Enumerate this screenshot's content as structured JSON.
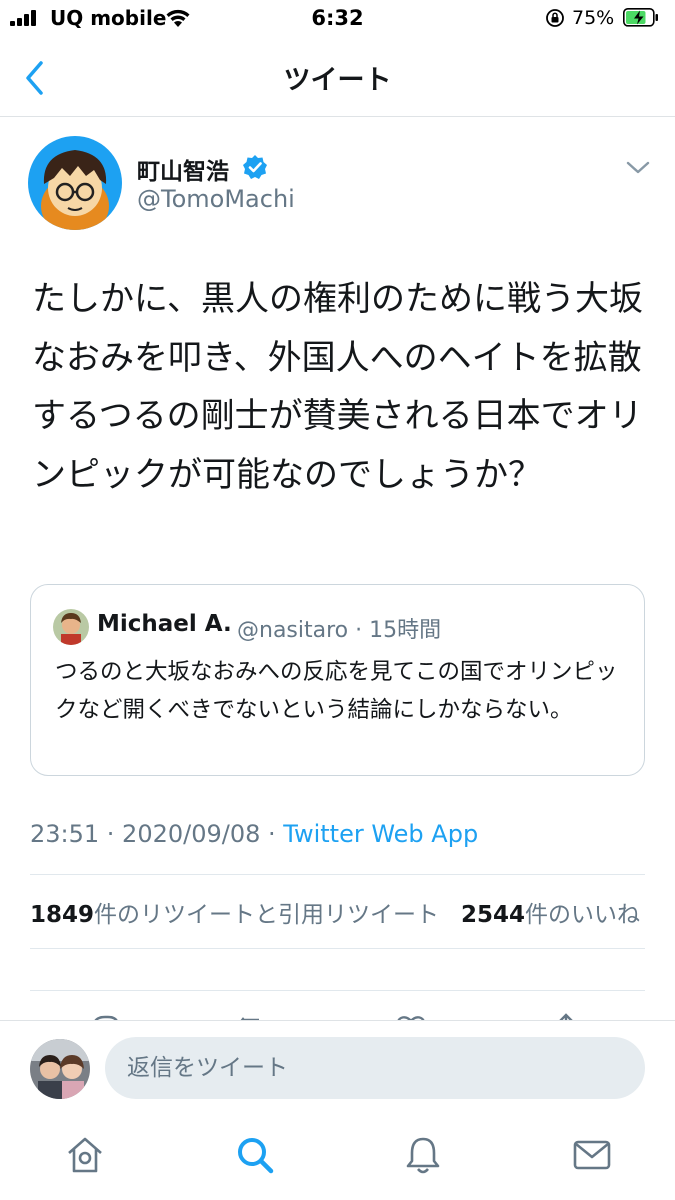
{
  "status_bar": {
    "carrier": "UQ mobile",
    "time": "6:32",
    "battery_percent": "75%",
    "battery_level": 0.75,
    "icons": [
      "signal-icon",
      "wifi-icon",
      "orientation-lock-icon",
      "battery-charging-icon"
    ]
  },
  "header": {
    "title": "ツイート",
    "back_icon": "chevron-left-icon"
  },
  "tweet": {
    "author_name": "町山智浩",
    "verified": true,
    "handle": "@TomoMachi",
    "text": "たしかに、黒人の権利のために戦う大坂なおみを叩き、外国人へのヘイトを拡散するつるの剛士が賛美される日本でオリンピックが可能なのでしょうか？",
    "quoted": {
      "name": "Michael A.",
      "handle_meta": "@nasitaro · 15時間",
      "text": "つるのと大坂なおみへの反応を見てこの国でオリンピックなど開くべきでないという結論にしかならない。"
    },
    "timestamp": "23:51 · 2020/09/08 · ",
    "source_app": "Twitter Web App",
    "retweet_count": "1849",
    "retweet_label": "件のリツイートと引用リツイート",
    "like_count": "2544",
    "like_label": "件のいいね"
  },
  "reply": {
    "placeholder": "返信をツイート"
  },
  "tabbar": {
    "items": [
      "home-icon",
      "search-icon",
      "notifications-icon",
      "messages-icon"
    ]
  },
  "colors": {
    "accent": "#1da1f2",
    "secondary_text": "#657786",
    "border": "#ccd6dd",
    "battery_green": "#4cd964"
  }
}
